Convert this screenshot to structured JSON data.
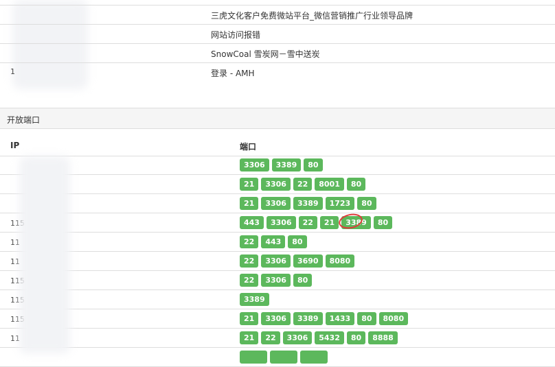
{
  "recent_sites": [
    {
      "ip_prefix": "",
      "title": "三虎文化客户免费微站平台_微信营销推广行业领导品牌"
    },
    {
      "ip_prefix": "",
      "title": "网站访问报错"
    },
    {
      "ip_prefix": "",
      "title": "SnowCoal 雪炭网－雪中送炭"
    },
    {
      "ip_prefix": "1",
      "title": "登录 - AMH"
    }
  ],
  "open_ports": {
    "section_title": "开放端口",
    "col_ip": "IP",
    "col_ports": "端口",
    "rows": [
      {
        "ip": "",
        "ports": [
          "3306",
          "3389",
          "80"
        ]
      },
      {
        "ip": "",
        "ports": [
          "21",
          "3306",
          "22",
          "8001",
          "80"
        ]
      },
      {
        "ip": "",
        "ports": [
          "21",
          "3306",
          "3389",
          "1723",
          "80"
        ]
      },
      {
        "ip": "115",
        "ports": [
          "443",
          "3306",
          "22",
          "21",
          "3389",
          "80"
        ]
      },
      {
        "ip": "11",
        "ports": [
          "22",
          "443",
          "80"
        ]
      },
      {
        "ip": "11",
        "ports": [
          "22",
          "3306",
          "3690",
          "8080"
        ]
      },
      {
        "ip": "115",
        "ports": [
          "22",
          "3306",
          "80"
        ]
      },
      {
        "ip": "115",
        "ports": [
          "3389"
        ]
      },
      {
        "ip": "115",
        "ports": [
          "21",
          "3306",
          "3389",
          "1433",
          "80",
          "8080"
        ]
      },
      {
        "ip": "11",
        "ports": [
          "21",
          "22",
          "3306",
          "5432",
          "80",
          "8888"
        ]
      },
      {
        "ip": "",
        "ports": [
          "",
          "",
          ""
        ]
      }
    ]
  },
  "colors": {
    "badge": "#5cb85c",
    "highlight": "#e03a3a",
    "header_bg": "#f5f5f5"
  }
}
